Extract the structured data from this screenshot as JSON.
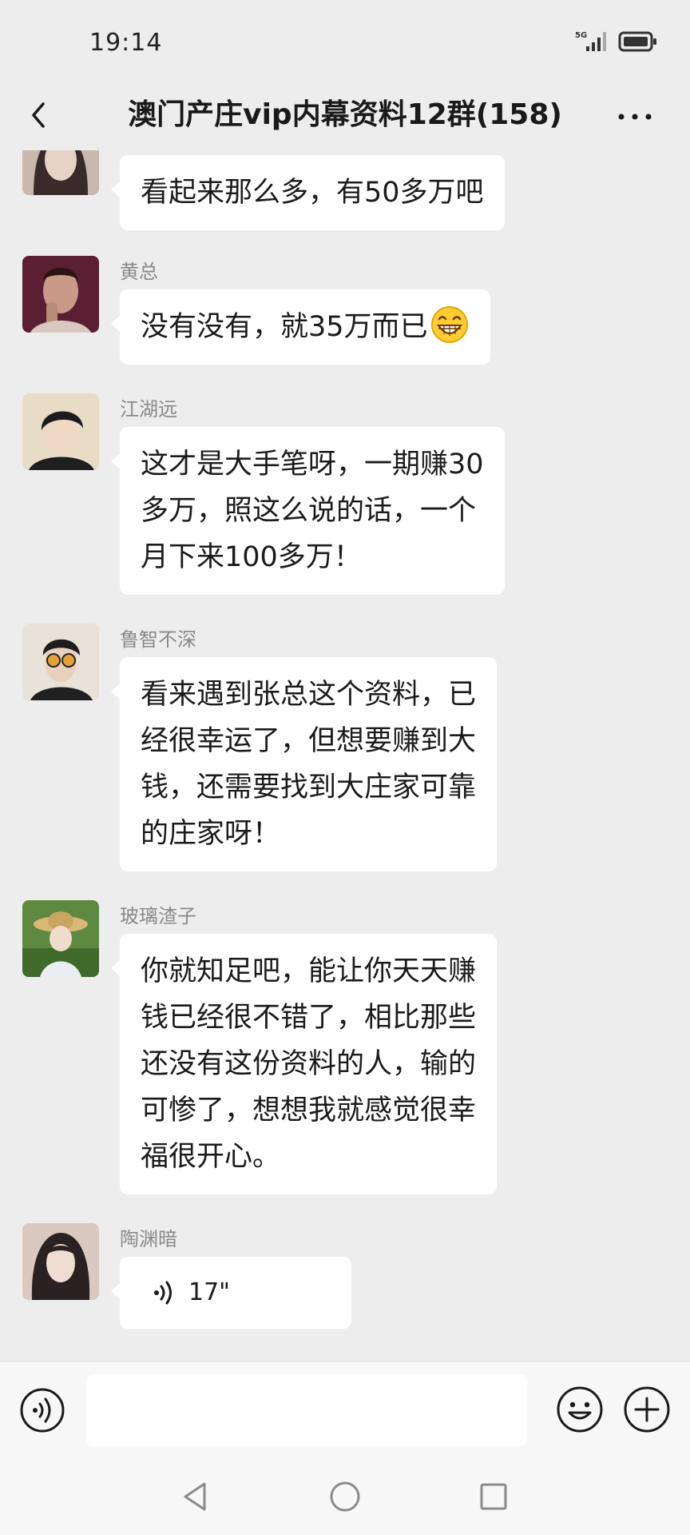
{
  "status_bar": {
    "time": "19:14",
    "network": "5G"
  },
  "header": {
    "title": "澳门产庄vip内幕资料12群(158)"
  },
  "messages": [
    {
      "sender": "",
      "lines": [
        "看起来那么多，有50多万吧"
      ],
      "avatar_colors": [
        "#3a2b2b",
        "#d9c2b5"
      ]
    },
    {
      "sender": "黄总",
      "lines": [
        "没有没有，就35万而已"
      ],
      "has_emoji": true,
      "emoji_name": "grinning-face-icon",
      "avatar_colors": [
        "#4a1a2a",
        "#c89a8a"
      ]
    },
    {
      "sender": "江湖远",
      "lines": [
        "这才是大手笔呀，一期赚30",
        "多万，照这么说的话，一个",
        "月下来100多万！"
      ],
      "avatar_colors": [
        "#e8d8c0",
        "#1c1c1c"
      ]
    },
    {
      "sender": "鲁智不深",
      "lines": [
        "看来遇到张总这个资料，已",
        "经很幸运了，但想要赚到大",
        "钱，还需要找到大庄家可靠",
        "的庄家呀！"
      ],
      "avatar_colors": [
        "#e6e0d6",
        "#222222"
      ]
    },
    {
      "sender": "玻璃渣子",
      "lines": [
        "你就知足吧，能让你天天赚",
        "钱已经很不错了，相比那些",
        "还没有这份资料的人，输的",
        "可惨了，想想我就感觉很幸",
        "福很开心。"
      ],
      "avatar_colors": [
        "#4f7a3a",
        "#d8c8a8"
      ]
    },
    {
      "sender": "陶渊暗",
      "voice_duration": "17\"",
      "avatar_colors": [
        "#2a2222",
        "#e8d6cc"
      ]
    }
  ],
  "input": {
    "placeholder": ""
  },
  "colors": {
    "background": "#ededed",
    "bubble": "#ffffff",
    "sender_name": "#8a8a8a"
  }
}
